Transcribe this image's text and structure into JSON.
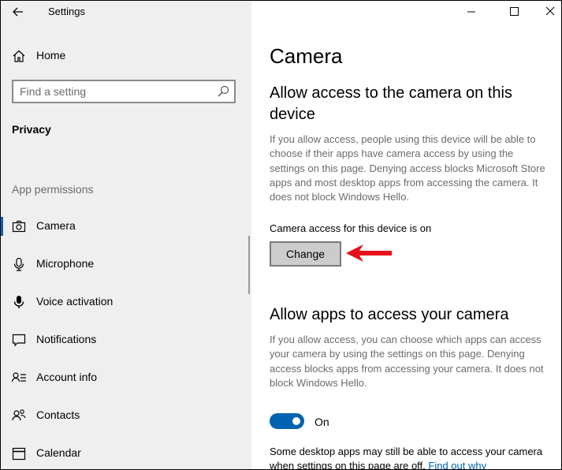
{
  "window": {
    "title": "Settings"
  },
  "sidebar": {
    "home_label": "Home",
    "search_placeholder": "Find a setting",
    "section_title": "Privacy",
    "subsection_title": "App permissions",
    "items": [
      {
        "label": "Camera",
        "icon": "camera-icon",
        "active": true
      },
      {
        "label": "Microphone",
        "icon": "microphone-icon"
      },
      {
        "label": "Voice activation",
        "icon": "voice-activation-icon"
      },
      {
        "label": "Notifications",
        "icon": "notifications-icon"
      },
      {
        "label": "Account info",
        "icon": "account-info-icon"
      },
      {
        "label": "Contacts",
        "icon": "contacts-icon"
      },
      {
        "label": "Calendar",
        "icon": "calendar-icon"
      }
    ]
  },
  "main": {
    "page_title": "Camera",
    "device_section": {
      "heading": "Allow access to the camera on this device",
      "description": "If you allow access, people using this device will be able to choose if their apps have camera access by using the settings on this page. Denying access blocks Microsoft Store apps and most desktop apps from accessing the camera. It does not block Windows Hello.",
      "status": "Camera access for this device is on",
      "change_label": "Change"
    },
    "apps_section": {
      "heading": "Allow apps to access your camera",
      "description": "If you allow access, you can choose which apps can access your camera by using the settings on this page. Denying access blocks apps from accessing your camera. It does not block Windows Hello.",
      "toggle_state": "On",
      "toggle_on": true
    },
    "footnote": {
      "text": "Some desktop apps may still be able to access your camera when settings on this page are off. ",
      "link": "Find out why"
    }
  },
  "colors": {
    "accent": "#0063b1",
    "annotation_arrow": "#e8101a"
  }
}
